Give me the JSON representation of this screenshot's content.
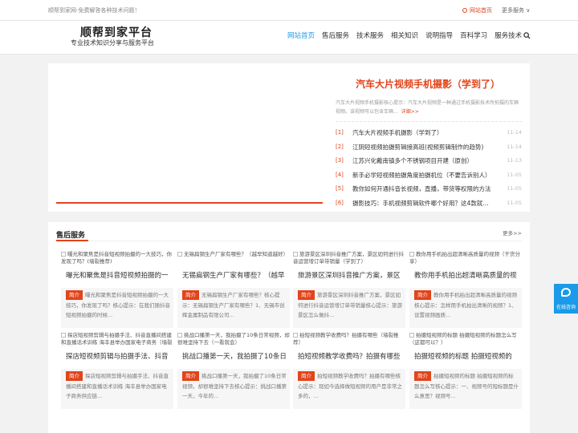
{
  "topbar": {
    "tagline": "顺帮到家网-免费解答各种技术问题！",
    "home_link": "网站首页",
    "services_link": "更多服务 ∨"
  },
  "header": {
    "logo_title": "顺帮到家平台",
    "logo_subtitle": "专业技术知识分享与服务平台",
    "nav": [
      "网站首页",
      "售后服务",
      "技术服务",
      "相关知识",
      "说明指导",
      "百科学习",
      "服务技术"
    ]
  },
  "featured": {
    "title": "汽车大片视频手机摄影（学到了）",
    "desc": "汽车大片视频手机摄影核心提示：汽车大片视频是一种通过手机摄影技术所拍摄的车辆视频。该视频可以包含车辆...",
    "more": "详细>>",
    "list": [
      {
        "num": "[1]",
        "text": "汽车大片视频手机摄影（学到了）",
        "date": "11-14"
      },
      {
        "num": "[2]",
        "text": "江阴短视频拍摄剪辑接高班(视频剪辑制作的趋势)",
        "date": "11-14"
      },
      {
        "num": "[3]",
        "text": "江苏兴化戴南镇多个不锈钢项目开建（原创）",
        "date": "11-13"
      },
      {
        "num": "[4]",
        "text": "新手必学短视频拍摄角度拍摄机位（不要告诉别人）",
        "date": "11-05"
      },
      {
        "num": "[5]",
        "text": "教你如何开通抖音长视频，直播，带货等权限的方法",
        "date": "11-05"
      },
      {
        "num": "[6]",
        "text": "摄影技巧：手机视频剪辑软件哪个好用？这4款就够了",
        "date": "11-05"
      }
    ]
  },
  "section": {
    "title": "售后服务",
    "more": "更多>>",
    "badge": "简介",
    "cards": [
      {
        "thumb": "曝光和聚焦是抖音短视频拍摄的一大技巧，你发现了吗？(墙裂推荐)",
        "title": "曝光和聚焦是抖音短视频拍摄的一",
        "intro": "曝光和聚焦是抖音短视频拍摄的一大技巧，你发现了吗？核心提示：在我们随抖音短视频拍摄的时候..."
      },
      {
        "thumb": "无锡扁钢生产厂家有哪些？（越早知道越好）",
        "title": "无锡扁钢生产厂家有哪些？（越早",
        "intro": "无锡扁钢生产厂家有哪些？核心提示：无锡扁钢生产厂家有哪些？1、无锡市创辉金属制品有限公司..."
      },
      {
        "thumb": "旅游景区深圳抖音推广方案，景区如何进行抖音运营增订单带销量（学到了）",
        "title": "旅游景区深圳抖音推广方案，景区",
        "intro": "旅游景区深圳抖音推广方案，景区如何进行抖音运营增订单带销量核心提示：旅游景区怎么做抖..."
      },
      {
        "thumb": "教你用手机拍出超清晰高质量的视频（干货分享）",
        "title": "教你用手机拍出超清晰高质量的视",
        "intro": "教你用手机拍出超清晰高质量的视频核心提示：怎样用手机拍出清晰的视频？1、设置视频画质..."
      },
      {
        "thumb": "探店短视频剪辑与拍摄手法、抖音直播间搭建和直播话术训练 海丰县举办国家电子商务（墙裂推荐）",
        "title": "探店短视频剪辑与拍摄手法、抖音",
        "intro": "探店短视频剪辑与拍摄手法、抖音直播间搭建和直播话术训练 海丰县举办国家电子商务供应链..."
      },
      {
        "thumb": "挑战口播第一天，我拍摄了10条日常视频，却很难坚持下去（一看就会）",
        "title": "挑战口播第一天，我拍摄了10条日",
        "intro": "挑战口播第一天，我拍摄了10条日常视频，却很难坚持下去核心提示：挑战口播第一天，今年的..."
      },
      {
        "thumb": "拍短视频教学收费吗？拍摄有哪些（墙裂推荐）",
        "title": "拍短视频教学收费吗？拍摄有哪些",
        "intro": "拍短视频教学收费吗？拍摄有哪些核心提示：现如今选择做短视频的用户是非常之多的，..."
      },
      {
        "thumb": "拍摄短视频的标题 拍摄短视频的标题怎么写（这都可以？）",
        "title": "拍摄短视频的标题 拍摄短视频的",
        "intro": "拍摄短视频的标题 拍摄短视频的标题怎么写核心提示：一、视频号的短标题是什么意思？视频号..."
      }
    ]
  },
  "chat": {
    "label": "在线咨询"
  },
  "colors": {
    "accent": "#e2441b",
    "nav_active": "#1e9be7",
    "chat_bg": "#1a9ae8"
  }
}
